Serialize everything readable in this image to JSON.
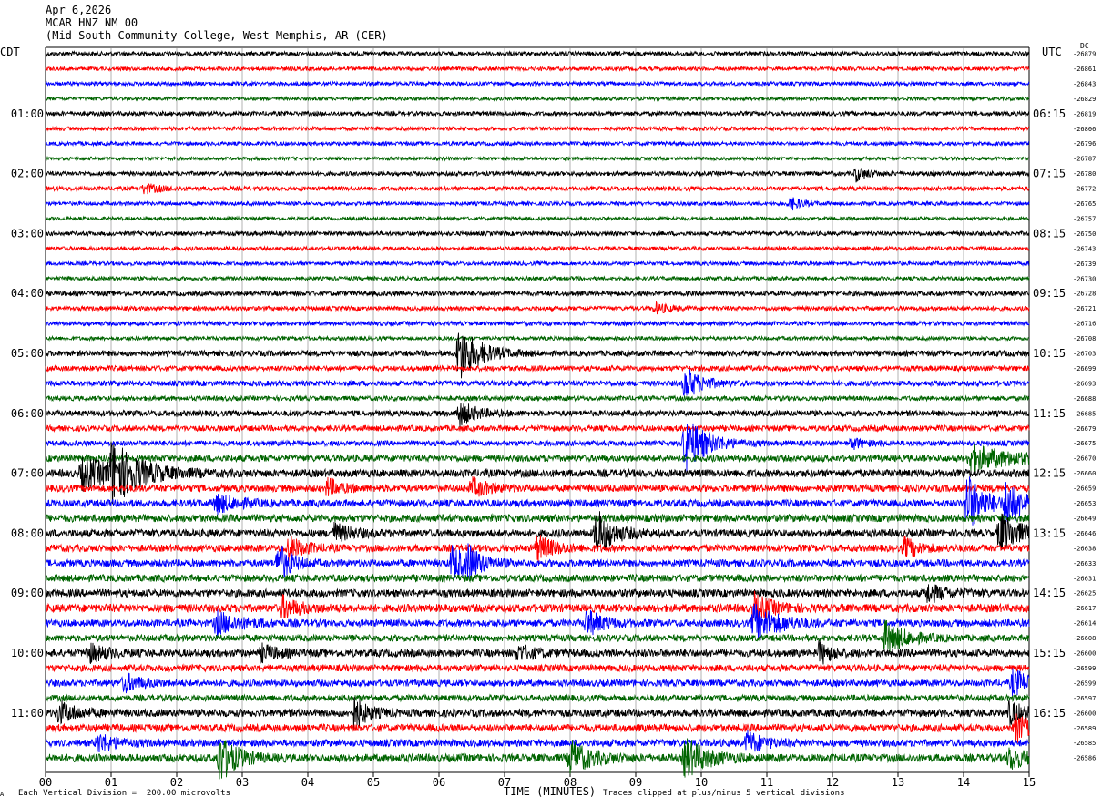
{
  "header": {
    "date": "Apr 6,2026",
    "station": "MCAR HNZ NM 00",
    "location": "(Mid-South Community College, West Memphis, AR (CER)"
  },
  "left_axis_label": "CDT",
  "right_axis_label": "UTC",
  "dc_label": "DC",
  "footer": {
    "scale": "Each Vertical Division =  200.00 microvolts",
    "xlabel": "TIME (MINUTES)",
    "clip_note": "Traces clipped at plus/minus 5 vertical divisions",
    "corner_mark": "A"
  },
  "colors": {
    "trace_cycle": [
      "#000000",
      "#ff0000",
      "#0000ff",
      "#006400"
    ],
    "grid": "#808080"
  },
  "chart_data": {
    "type": "line",
    "title": "MCAR HNZ NM 00",
    "xlabel": "TIME (MINUTES)",
    "x_ticks": [
      "00",
      "01",
      "02",
      "03",
      "04",
      "05",
      "06",
      "07",
      "08",
      "09",
      "10",
      "11",
      "12",
      "13",
      "14",
      "15"
    ],
    "xlim": [
      0,
      15
    ],
    "row_minutes": 15,
    "left_ticks": [
      "01:00",
      "02:00",
      "03:00",
      "04:00",
      "05:00",
      "06:00",
      "07:00",
      "08:00",
      "09:00",
      "10:00",
      "11:00"
    ],
    "right_ticks": [
      "06:15",
      "07:15",
      "08:15",
      "09:15",
      "10:15",
      "11:15",
      "12:15",
      "13:15",
      "14:15",
      "15:15",
      "16:15"
    ],
    "dc_offsets": [
      "-26879",
      "-26861",
      "-26843",
      "-26829",
      "-26819",
      "-26806",
      "-26796",
      "-26787",
      "-26780",
      "-26772",
      "-26765",
      "-26757",
      "-26750",
      "-26743",
      "-26739",
      "-26730",
      "-26728",
      "-26721",
      "-26716",
      "-26708",
      "-26703",
      "-26699",
      "-26693",
      "-26688",
      "-26685",
      "-26679",
      "-26675",
      "-26670",
      "-26660",
      "-26659",
      "-26653",
      "-26649",
      "-26646",
      "-26638",
      "-26633",
      "-26631",
      "-26625",
      "-26617",
      "-26614",
      "-26608",
      "-26600",
      "-26599",
      "-26599",
      "-26597",
      "-26600",
      "-26589",
      "-26585",
      "-26586"
    ],
    "row_noise": [
      0.9,
      0.8,
      0.8,
      0.7,
      0.9,
      0.8,
      0.8,
      0.7,
      0.9,
      0.9,
      0.8,
      0.7,
      0.9,
      0.8,
      0.8,
      0.8,
      1.0,
      0.9,
      0.9,
      0.8,
      1.2,
      1.1,
      1.1,
      1.0,
      1.2,
      1.2,
      1.1,
      1.4,
      1.6,
      1.5,
      1.5,
      1.6,
      1.6,
      1.5,
      1.5,
      1.5,
      1.6,
      1.7,
      1.5,
      1.4,
      1.6,
      1.4,
      1.4,
      1.3,
      1.6,
      1.6,
      1.5,
      1.7
    ],
    "events": [
      {
        "row": 8,
        "minute": 12.35,
        "amp": 8,
        "dur": 0.3
      },
      {
        "row": 9,
        "minute": 1.5,
        "amp": 5,
        "dur": 0.4
      },
      {
        "row": 10,
        "minute": 11.35,
        "amp": 8,
        "dur": 0.25
      },
      {
        "row": 17,
        "minute": 9.3,
        "amp": 6,
        "dur": 0.3
      },
      {
        "row": 20,
        "minute": 6.3,
        "amp": 30,
        "dur": 0.5
      },
      {
        "row": 24,
        "minute": 6.3,
        "amp": 14,
        "dur": 0.4
      },
      {
        "row": 22,
        "minute": 9.75,
        "amp": 18,
        "dur": 0.4
      },
      {
        "row": 26,
        "minute": 9.75,
        "amp": 32,
        "dur": 0.5
      },
      {
        "row": 26,
        "minute": 12.3,
        "amp": 6,
        "dur": 0.3
      },
      {
        "row": 27,
        "minute": 14.1,
        "amp": 14,
        "dur": 1.0
      },
      {
        "row": 28,
        "minute": 0.55,
        "amp": 16,
        "dur": 1.0
      },
      {
        "row": 28,
        "minute": 1.0,
        "amp": 30,
        "dur": 0.6
      },
      {
        "row": 29,
        "minute": 4.3,
        "amp": 10,
        "dur": 0.3
      },
      {
        "row": 29,
        "minute": 6.5,
        "amp": 10,
        "dur": 0.4
      },
      {
        "row": 30,
        "minute": 2.6,
        "amp": 10,
        "dur": 0.5
      },
      {
        "row": 30,
        "minute": 14.05,
        "amp": 34,
        "dur": 0.4
      },
      {
        "row": 30,
        "minute": 14.65,
        "amp": 26,
        "dur": 0.4
      },
      {
        "row": 32,
        "minute": 8.4,
        "amp": 26,
        "dur": 0.4
      },
      {
        "row": 32,
        "minute": 14.55,
        "amp": 22,
        "dur": 0.5
      },
      {
        "row": 32,
        "minute": 4.4,
        "amp": 10,
        "dur": 0.4
      },
      {
        "row": 33,
        "minute": 3.7,
        "amp": 12,
        "dur": 0.4
      },
      {
        "row": 33,
        "minute": 7.5,
        "amp": 14,
        "dur": 0.4
      },
      {
        "row": 33,
        "minute": 13.1,
        "amp": 10,
        "dur": 0.4
      },
      {
        "row": 34,
        "minute": 3.55,
        "amp": 22,
        "dur": 0.3
      },
      {
        "row": 34,
        "minute": 6.2,
        "amp": 20,
        "dur": 0.4
      },
      {
        "row": 34,
        "minute": 6.45,
        "amp": 14,
        "dur": 0.3
      },
      {
        "row": 36,
        "minute": 13.45,
        "amp": 10,
        "dur": 0.4
      },
      {
        "row": 37,
        "minute": 3.6,
        "amp": 12,
        "dur": 0.4
      },
      {
        "row": 37,
        "minute": 10.8,
        "amp": 16,
        "dur": 0.4
      },
      {
        "row": 38,
        "minute": 2.6,
        "amp": 12,
        "dur": 0.6
      },
      {
        "row": 38,
        "minute": 8.25,
        "amp": 14,
        "dur": 0.4
      },
      {
        "row": 38,
        "minute": 10.8,
        "amp": 20,
        "dur": 0.6
      },
      {
        "row": 39,
        "minute": 12.8,
        "amp": 18,
        "dur": 0.5
      },
      {
        "row": 40,
        "minute": 0.65,
        "amp": 10,
        "dur": 0.4
      },
      {
        "row": 40,
        "minute": 3.3,
        "amp": 8,
        "dur": 0.4
      },
      {
        "row": 40,
        "minute": 7.2,
        "amp": 8,
        "dur": 0.4
      },
      {
        "row": 40,
        "minute": 11.8,
        "amp": 12,
        "dur": 0.3
      },
      {
        "row": 42,
        "minute": 1.2,
        "amp": 10,
        "dur": 0.4
      },
      {
        "row": 42,
        "minute": 14.75,
        "amp": 14,
        "dur": 0.5
      },
      {
        "row": 44,
        "minute": 0.2,
        "amp": 12,
        "dur": 0.4
      },
      {
        "row": 44,
        "minute": 4.7,
        "amp": 18,
        "dur": 0.3
      },
      {
        "row": 44,
        "minute": 14.7,
        "amp": 12,
        "dur": 0.4
      },
      {
        "row": 45,
        "minute": 14.8,
        "amp": 14,
        "dur": 0.4
      },
      {
        "row": 46,
        "minute": 0.8,
        "amp": 10,
        "dur": 0.4
      },
      {
        "row": 46,
        "minute": 10.7,
        "amp": 12,
        "dur": 0.4
      },
      {
        "row": 47,
        "minute": 2.65,
        "amp": 26,
        "dur": 0.4
      },
      {
        "row": 47,
        "minute": 8.0,
        "amp": 18,
        "dur": 0.5
      },
      {
        "row": 47,
        "minute": 9.75,
        "amp": 22,
        "dur": 0.5
      },
      {
        "row": 47,
        "minute": 14.7,
        "amp": 12,
        "dur": 0.4
      }
    ]
  }
}
